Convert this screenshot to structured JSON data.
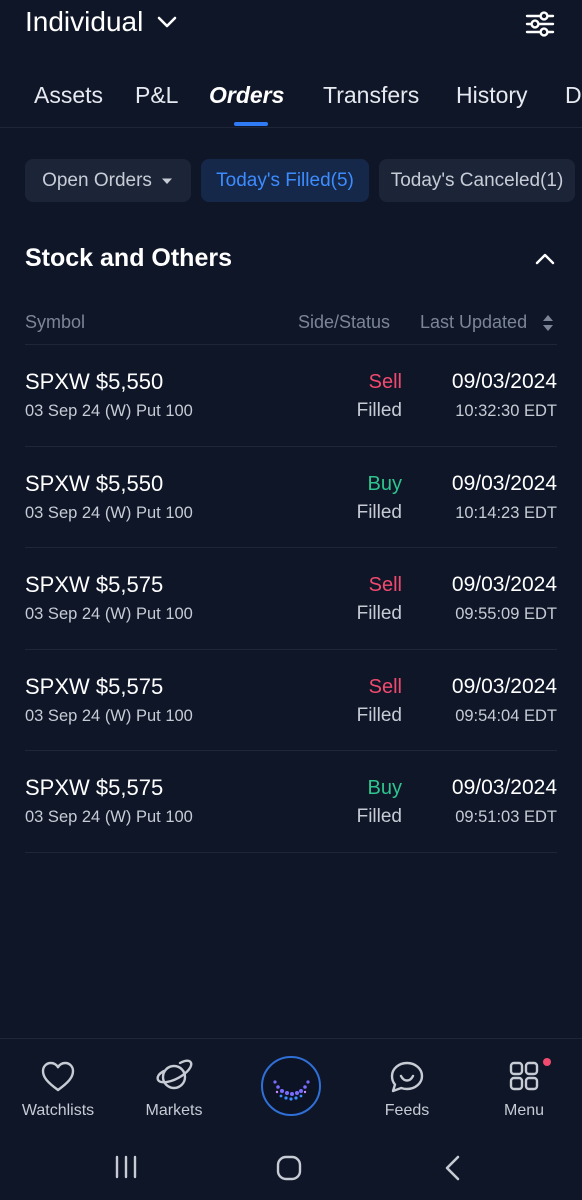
{
  "header": {
    "account_label": "Individual"
  },
  "tabs": [
    {
      "label": "Assets"
    },
    {
      "label": "P&L"
    },
    {
      "label": "Orders"
    },
    {
      "label": "Transfers"
    },
    {
      "label": "History"
    },
    {
      "label": "D"
    }
  ],
  "active_tab": "Orders",
  "filters": {
    "open_orders": "Open Orders",
    "todays_filled": "Today's Filled(5)",
    "todays_canceled": "Today's Canceled(1)"
  },
  "section": {
    "title": "Stock and Others",
    "columns": {
      "symbol": "Symbol",
      "side_status": "Side/Status",
      "last_updated": "Last Updated"
    }
  },
  "orders": [
    {
      "symbol": "SPXW $5,550",
      "detail": "03 Sep 24 (W) Put 100",
      "side": "Sell",
      "status": "Filled",
      "date": "09/03/2024",
      "time": "10:32:30 EDT"
    },
    {
      "symbol": "SPXW $5,550",
      "detail": "03 Sep 24 (W) Put 100",
      "side": "Buy",
      "status": "Filled",
      "date": "09/03/2024",
      "time": "10:14:23 EDT"
    },
    {
      "symbol": "SPXW $5,575",
      "detail": "03 Sep 24 (W) Put 100",
      "side": "Sell",
      "status": "Filled",
      "date": "09/03/2024",
      "time": "09:55:09 EDT"
    },
    {
      "symbol": "SPXW $5,575",
      "detail": "03 Sep 24 (W) Put 100",
      "side": "Sell",
      "status": "Filled",
      "date": "09/03/2024",
      "time": "09:54:04 EDT"
    },
    {
      "symbol": "SPXW $5,575",
      "detail": "03 Sep 24 (W) Put 100",
      "side": "Buy",
      "status": "Filled",
      "date": "09/03/2024",
      "time": "09:51:03 EDT"
    }
  ],
  "bottom_nav": {
    "watchlists": "Watchlists",
    "markets": "Markets",
    "feeds": "Feeds",
    "menu": "Menu"
  },
  "colors": {
    "background": "#0f1628",
    "accent": "#2f7bf5",
    "sell": "#f04a6e",
    "buy": "#2ec48d"
  },
  "icons": [
    "chevron-down-icon",
    "sliders-icon",
    "caret-down-icon",
    "chevron-up-icon",
    "sort-icon",
    "heart-icon",
    "planet-icon",
    "app-logo-icon",
    "chat-smile-icon",
    "grid-icon",
    "recent-apps-icon",
    "home-icon",
    "back-icon"
  ]
}
